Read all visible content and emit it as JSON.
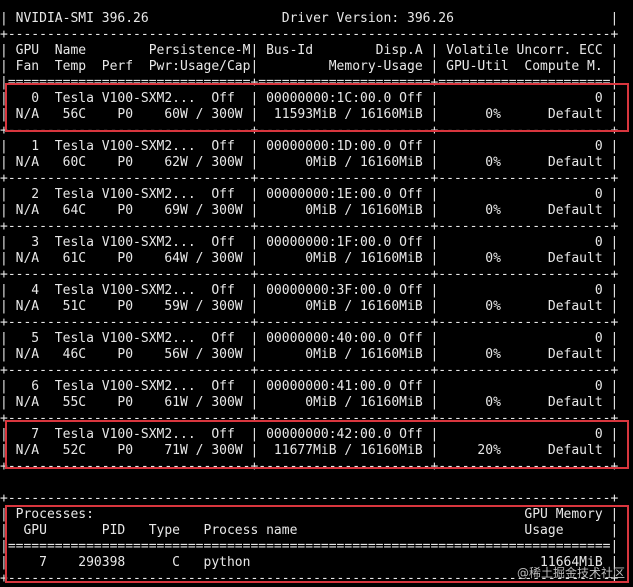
{
  "header": {
    "banner": "| NVIDIA-SMI 396.26                 Driver Version: 396.26                    |",
    "top": "+-----------------------------------------------------------------------------+",
    "col_row1": "| GPU  Name        Persistence-M| Bus-Id        Disp.A | Volatile Uncorr. ECC |",
    "col_row2": "| Fan  Temp  Perf  Pwr:Usage/Cap|         Memory-Usage | GPU-Util  Compute M. |",
    "separator": "|===============================+======================+======================|"
  },
  "gpus": [
    {
      "line1": "|   0  Tesla V100-SXM2...  Off  | 00000000:1C:00.0 Off |                    0 |",
      "line2": "| N/A   56C    P0    60W / 300W |  11593MiB / 16160MiB |      0%      Default |",
      "sep": "+-------------------------------+----------------------+----------------------+"
    },
    {
      "line1": "|   1  Tesla V100-SXM2...  Off  | 00000000:1D:00.0 Off |                    0 |",
      "line2": "| N/A   60C    P0    62W / 300W |      0MiB / 16160MiB |      0%      Default |",
      "sep": "+-------------------------------+----------------------+----------------------+"
    },
    {
      "line1": "|   2  Tesla V100-SXM2...  Off  | 00000000:1E:00.0 Off |                    0 |",
      "line2": "| N/A   64C    P0    69W / 300W |      0MiB / 16160MiB |      0%      Default |",
      "sep": "+-------------------------------+----------------------+----------------------+"
    },
    {
      "line1": "|   3  Tesla V100-SXM2...  Off  | 00000000:1F:00.0 Off |                    0 |",
      "line2": "| N/A   61C    P0    64W / 300W |      0MiB / 16160MiB |      0%      Default |",
      "sep": "+-------------------------------+----------------------+----------------------+"
    },
    {
      "line1": "|   4  Tesla V100-SXM2...  Off  | 00000000:3F:00.0 Off |                    0 |",
      "line2": "| N/A   51C    P0    59W / 300W |      0MiB / 16160MiB |      0%      Default |",
      "sep": "+-------------------------------+----------------------+----------------------+"
    },
    {
      "line1": "|   5  Tesla V100-SXM2...  Off  | 00000000:40:00.0 Off |                    0 |",
      "line2": "| N/A   46C    P0    56W / 300W |      0MiB / 16160MiB |      0%      Default |",
      "sep": "+-------------------------------+----------------------+----------------------+"
    },
    {
      "line1": "|   6  Tesla V100-SXM2...  Off  | 00000000:41:00.0 Off |                    0 |",
      "line2": "| N/A   55C    P0    61W / 300W |      0MiB / 16160MiB |      0%      Default |",
      "sep": "+-------------------------------+----------------------+----------------------+"
    },
    {
      "line1": "|   7  Tesla V100-SXM2...  Off  | 00000000:42:00.0 Off |                    0 |",
      "line2": "| N/A   52C    P0    71W / 300W |  11677MiB / 16160MiB |     20%      Default |",
      "sep": "+-------------------------------+----------------------+----------------------+"
    }
  ],
  "processes": {
    "top": "+-----------------------------------------------------------------------------+",
    "title": "| Processes:                                                       GPU Memory |",
    "cols": "|  GPU       PID   Type   Process name                             Usage      |",
    "separator": "|=============================================================================|",
    "row": "|    7    290398      C   python                                     11664MiB |",
    "bottom": "+-----------------------------------------------------------------------------+"
  },
  "watermark": "@稀土掘金技术社区",
  "highlight_color": "#d9363e"
}
